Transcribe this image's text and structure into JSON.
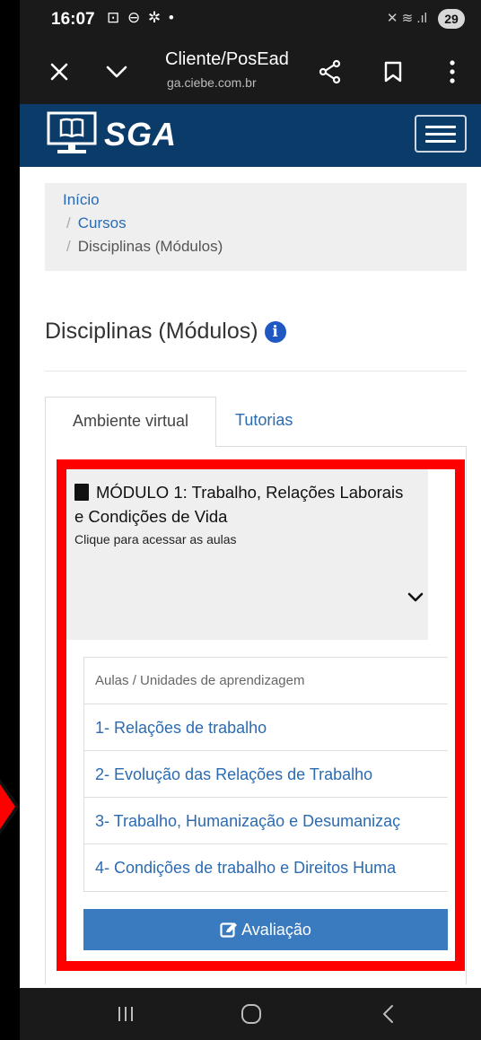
{
  "status_bar": {
    "time": "16:07",
    "left_icons": "⊡ ⊖ ✲ •",
    "right_icons": "✕ ≋ .ıl",
    "battery": "29"
  },
  "browser": {
    "title": "Cliente/PosEad",
    "url": "ga.ciebe.com.br",
    "icons": [
      "close-icon",
      "chevron-down-icon",
      "share-icon",
      "bookmark-icon",
      "more-vertical-icon"
    ]
  },
  "header": {
    "brand": "SGA",
    "brand_color": "#0b3b69"
  },
  "breadcrumb": {
    "items": [
      "Início",
      "Cursos",
      "Disciplinas (Módulos)"
    ],
    "separator": "/"
  },
  "page": {
    "title": "Disciplinas (Módulos)"
  },
  "tabs": [
    {
      "label": "Ambiente virtual",
      "active": true
    },
    {
      "label": "Tutorias",
      "active": false
    }
  ],
  "module": {
    "title": "MÓDULO 1: Trabalho, Relações Laborais e Condições de Vida",
    "subtitle": "Clique para acessar as aulas",
    "units_header": "Aulas / Unidades de aprendizagem",
    "units": [
      "1- Relações de trabalho",
      "2- Evolução das Relações de Trabalho",
      "3- Trabalho, Humanização e Desumanizaç",
      "4- Condições de trabalho e Direitos Huma"
    ],
    "evaluation_label": "Avaliação"
  },
  "colors": {
    "link": "#2a6bb1",
    "button": "#3a7bbf",
    "highlight": "#ff0000"
  }
}
